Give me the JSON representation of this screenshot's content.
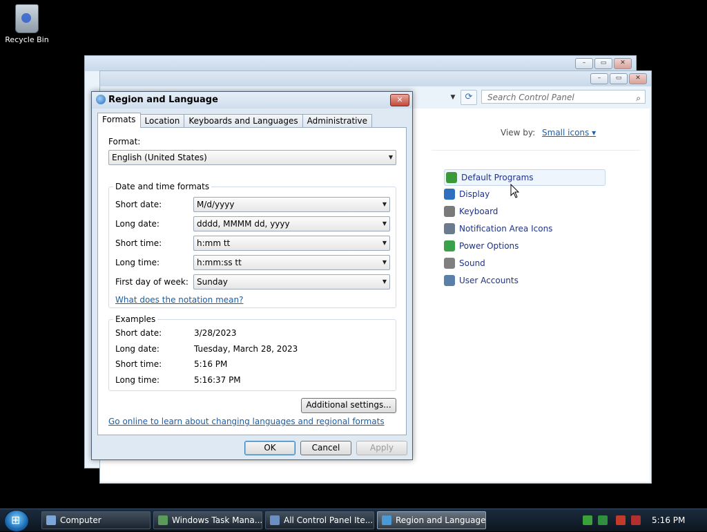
{
  "desktop": {
    "recycle_bin_label": "Recycle Bin"
  },
  "control_panel": {
    "search_placeholder": "Search Control Panel",
    "view_by_label": "View by:",
    "view_by_value": "Small icons",
    "items": [
      {
        "label": "Default Programs",
        "icon": "default-programs-icon",
        "color": "#3a9a3a"
      },
      {
        "label": "Display",
        "icon": "display-icon",
        "color": "#2f6fbf"
      },
      {
        "label": "Keyboard",
        "icon": "keyboard-icon",
        "color": "#7a7a7a"
      },
      {
        "label": "Notification Area Icons",
        "icon": "notification-icon",
        "color": "#6a7b8d"
      },
      {
        "label": "Power Options",
        "icon": "power-icon",
        "color": "#3aa04a"
      },
      {
        "label": "Sound",
        "icon": "speaker-icon",
        "color": "#808080"
      },
      {
        "label": "User Accounts",
        "icon": "users-icon",
        "color": "#5a7fa8"
      }
    ]
  },
  "dialog": {
    "title": "Region and Language",
    "tabs": [
      "Formats",
      "Location",
      "Keyboards and Languages",
      "Administrative"
    ],
    "format_label": "Format:",
    "format_value": "English (United States)",
    "date_time_group": "Date and time formats",
    "rows": [
      {
        "label": "Short date:",
        "value": "M/d/yyyy"
      },
      {
        "label": "Long date:",
        "value": "dddd, MMMM dd, yyyy"
      },
      {
        "label": "Short time:",
        "value": "h:mm tt"
      },
      {
        "label": "Long time:",
        "value": "h:mm:ss tt"
      },
      {
        "label": "First day of week:",
        "value": "Sunday"
      }
    ],
    "notation_link": "What does the notation mean?",
    "examples_group": "Examples",
    "examples": [
      {
        "label": "Short date:",
        "value": "3/28/2023"
      },
      {
        "label": "Long date:",
        "value": "Tuesday, March 28, 2023"
      },
      {
        "label": "Short time:",
        "value": "5:16 PM"
      },
      {
        "label": "Long time:",
        "value": "5:16:37 PM"
      }
    ],
    "additional_button": "Additional settings...",
    "online_link": "Go online to learn about changing languages and regional formats",
    "ok": "OK",
    "cancel": "Cancel",
    "apply": "Apply"
  },
  "taskbar": {
    "buttons": [
      {
        "label": "Computer",
        "active": false
      },
      {
        "label": "Windows Task Mana...",
        "active": false
      },
      {
        "label": "All Control Panel Ite...",
        "active": false
      },
      {
        "label": "Region and Language",
        "active": true
      }
    ],
    "clock": "5:16 PM"
  }
}
